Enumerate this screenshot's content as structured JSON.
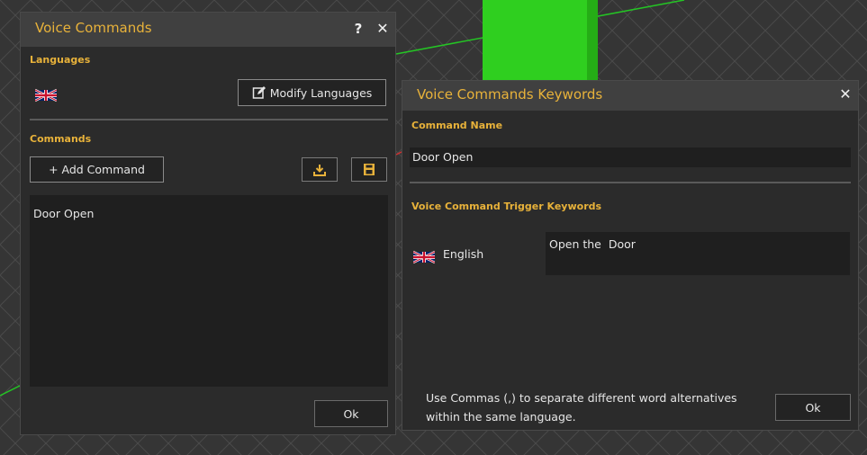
{
  "left_panel": {
    "title": "Voice Commands",
    "help_label": "?",
    "close_label": "✕",
    "languages_label": "Languages",
    "modify_languages_label": "Modify Languages",
    "commands_label": "Commands",
    "add_command_label": "+ Add Command",
    "commands": [
      "Door Open"
    ],
    "ok_label": "Ok"
  },
  "right_panel": {
    "title": "Voice Commands Keywords",
    "close_label": "✕",
    "command_name_label": "Command Name",
    "command_name_value": "Door Open",
    "trigger_label": "Voice Command Trigger Keywords",
    "language_name": "English",
    "keywords_value": "Open the  Door",
    "hint_line1": "Use Commas (,) to separate different word alternatives",
    "hint_line2": "within the same language.",
    "ok_label": "Ok"
  },
  "colors": {
    "accent": "#e8b23a",
    "panel_bg": "#2b2b2b",
    "titlebar_bg": "#404040",
    "cube_green": "#2fcf1f"
  }
}
